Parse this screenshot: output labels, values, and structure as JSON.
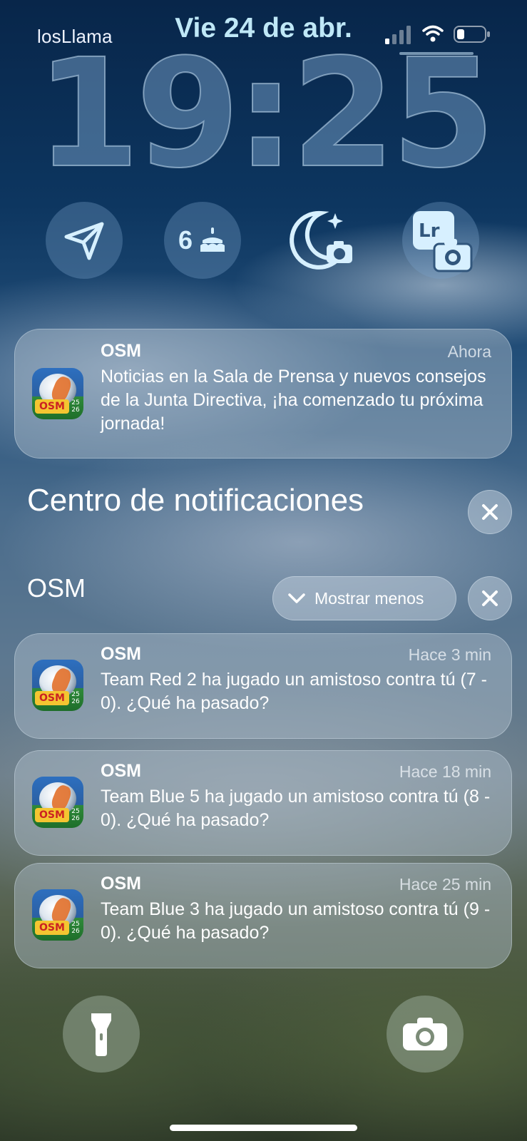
{
  "status_bar": {
    "carrier": "losLlama",
    "date": "Vie 24 de abr."
  },
  "clock": {
    "time": "19:25"
  },
  "widgets": {
    "send": {
      "icon": "paper-plane-icon"
    },
    "birthdays": {
      "count": "6",
      "icon": "cake-icon"
    },
    "camera_moon": {
      "icon": "moon-camera-icon"
    },
    "lightroom": {
      "icon": "lightroom-camera-icon",
      "label": "Lr"
    }
  },
  "banner": {
    "app": "OSM",
    "time": "Ahora",
    "body": "Noticias en la Sala de Prensa y nuevos consejos de la Junta Directiva, ¡ha comenzado tu próxima jornada!"
  },
  "notification_center": {
    "title": "Centro de notificaciones",
    "group": {
      "app": "OSM",
      "show_less_label": "Mostrar menos",
      "items": [
        {
          "app": "OSM",
          "time": "Hace 3 min",
          "body": "Team Red 2 ha jugado un amistoso contra tú (7 - 0). ¿Qué ha pasado?"
        },
        {
          "app": "OSM",
          "time": "Hace 18 min",
          "body": "Team Blue 5 ha jugado un amistoso contra tú (8 - 0). ¿Qué ha pasado?"
        },
        {
          "app": "OSM",
          "time": "Hace 25 min",
          "body": "Team Blue 3 ha jugado un amistoso contra tú (9 - 0). ¿Qué ha pasado?"
        }
      ]
    }
  },
  "app_icon": {
    "logo_text": "OSM",
    "year_top": "25",
    "year_bottom": "26"
  },
  "bottom": {
    "flashlight": {
      "icon": "flashlight-icon"
    },
    "camera": {
      "icon": "camera-icon"
    }
  },
  "colors": {
    "date_text": "#bfe8f7",
    "widget_bg": "#78a0c8"
  }
}
